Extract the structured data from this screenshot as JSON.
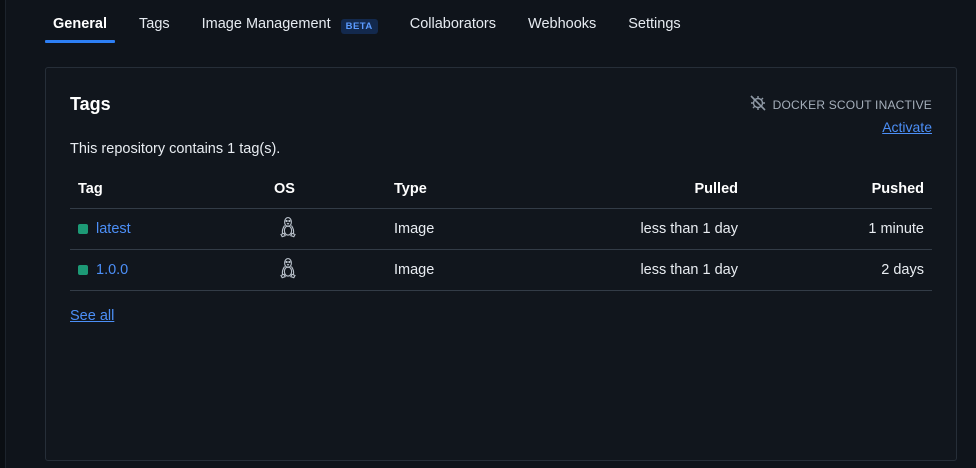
{
  "tabs": [
    {
      "label": "General",
      "active": true
    },
    {
      "label": "Tags",
      "active": false
    },
    {
      "label": "Image Management",
      "badge": "BETA",
      "active": false
    },
    {
      "label": "Collaborators",
      "active": false
    },
    {
      "label": "Webhooks",
      "active": false
    },
    {
      "label": "Settings",
      "active": false
    }
  ],
  "card": {
    "title": "Tags",
    "summary": "This repository contains 1 tag(s).",
    "scout": {
      "status": "DOCKER SCOUT INACTIVE",
      "icon": "scout-off-icon",
      "activate_label": "Activate"
    },
    "columns": [
      "Tag",
      "OS",
      "Type",
      "Pulled",
      "Pushed"
    ],
    "rows": [
      {
        "tag": "latest",
        "os_icon": "linux-icon",
        "type": "Image",
        "pulled": "less than 1 day",
        "pushed": "1 minute"
      },
      {
        "tag": "1.0.0",
        "os_icon": "linux-icon",
        "type": "Image",
        "pulled": "less than 1 day",
        "pushed": "2 days"
      }
    ],
    "see_all_label": "See all"
  },
  "colors": {
    "accent": "#2d7ff5",
    "link": "#4c8ff7",
    "status_dot": "#1d9a76",
    "background": "#0f141b"
  }
}
